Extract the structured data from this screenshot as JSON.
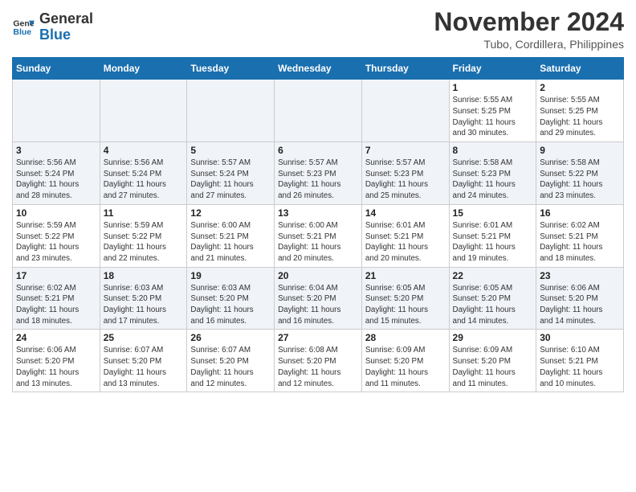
{
  "logo": {
    "line1": "General",
    "line2": "Blue"
  },
  "title": "November 2024",
  "subtitle": "Tubo, Cordillera, Philippines",
  "days_of_week": [
    "Sunday",
    "Monday",
    "Tuesday",
    "Wednesday",
    "Thursday",
    "Friday",
    "Saturday"
  ],
  "weeks": [
    [
      {
        "day": "",
        "info": ""
      },
      {
        "day": "",
        "info": ""
      },
      {
        "day": "",
        "info": ""
      },
      {
        "day": "",
        "info": ""
      },
      {
        "day": "",
        "info": ""
      },
      {
        "day": "1",
        "info": "Sunrise: 5:55 AM\nSunset: 5:25 PM\nDaylight: 11 hours\nand 30 minutes."
      },
      {
        "day": "2",
        "info": "Sunrise: 5:55 AM\nSunset: 5:25 PM\nDaylight: 11 hours\nand 29 minutes."
      }
    ],
    [
      {
        "day": "3",
        "info": "Sunrise: 5:56 AM\nSunset: 5:24 PM\nDaylight: 11 hours\nand 28 minutes."
      },
      {
        "day": "4",
        "info": "Sunrise: 5:56 AM\nSunset: 5:24 PM\nDaylight: 11 hours\nand 27 minutes."
      },
      {
        "day": "5",
        "info": "Sunrise: 5:57 AM\nSunset: 5:24 PM\nDaylight: 11 hours\nand 27 minutes."
      },
      {
        "day": "6",
        "info": "Sunrise: 5:57 AM\nSunset: 5:23 PM\nDaylight: 11 hours\nand 26 minutes."
      },
      {
        "day": "7",
        "info": "Sunrise: 5:57 AM\nSunset: 5:23 PM\nDaylight: 11 hours\nand 25 minutes."
      },
      {
        "day": "8",
        "info": "Sunrise: 5:58 AM\nSunset: 5:23 PM\nDaylight: 11 hours\nand 24 minutes."
      },
      {
        "day": "9",
        "info": "Sunrise: 5:58 AM\nSunset: 5:22 PM\nDaylight: 11 hours\nand 23 minutes."
      }
    ],
    [
      {
        "day": "10",
        "info": "Sunrise: 5:59 AM\nSunset: 5:22 PM\nDaylight: 11 hours\nand 23 minutes."
      },
      {
        "day": "11",
        "info": "Sunrise: 5:59 AM\nSunset: 5:22 PM\nDaylight: 11 hours\nand 22 minutes."
      },
      {
        "day": "12",
        "info": "Sunrise: 6:00 AM\nSunset: 5:21 PM\nDaylight: 11 hours\nand 21 minutes."
      },
      {
        "day": "13",
        "info": "Sunrise: 6:00 AM\nSunset: 5:21 PM\nDaylight: 11 hours\nand 20 minutes."
      },
      {
        "day": "14",
        "info": "Sunrise: 6:01 AM\nSunset: 5:21 PM\nDaylight: 11 hours\nand 20 minutes."
      },
      {
        "day": "15",
        "info": "Sunrise: 6:01 AM\nSunset: 5:21 PM\nDaylight: 11 hours\nand 19 minutes."
      },
      {
        "day": "16",
        "info": "Sunrise: 6:02 AM\nSunset: 5:21 PM\nDaylight: 11 hours\nand 18 minutes."
      }
    ],
    [
      {
        "day": "17",
        "info": "Sunrise: 6:02 AM\nSunset: 5:21 PM\nDaylight: 11 hours\nand 18 minutes."
      },
      {
        "day": "18",
        "info": "Sunrise: 6:03 AM\nSunset: 5:20 PM\nDaylight: 11 hours\nand 17 minutes."
      },
      {
        "day": "19",
        "info": "Sunrise: 6:03 AM\nSunset: 5:20 PM\nDaylight: 11 hours\nand 16 minutes."
      },
      {
        "day": "20",
        "info": "Sunrise: 6:04 AM\nSunset: 5:20 PM\nDaylight: 11 hours\nand 16 minutes."
      },
      {
        "day": "21",
        "info": "Sunrise: 6:05 AM\nSunset: 5:20 PM\nDaylight: 11 hours\nand 15 minutes."
      },
      {
        "day": "22",
        "info": "Sunrise: 6:05 AM\nSunset: 5:20 PM\nDaylight: 11 hours\nand 14 minutes."
      },
      {
        "day": "23",
        "info": "Sunrise: 6:06 AM\nSunset: 5:20 PM\nDaylight: 11 hours\nand 14 minutes."
      }
    ],
    [
      {
        "day": "24",
        "info": "Sunrise: 6:06 AM\nSunset: 5:20 PM\nDaylight: 11 hours\nand 13 minutes."
      },
      {
        "day": "25",
        "info": "Sunrise: 6:07 AM\nSunset: 5:20 PM\nDaylight: 11 hours\nand 13 minutes."
      },
      {
        "day": "26",
        "info": "Sunrise: 6:07 AM\nSunset: 5:20 PM\nDaylight: 11 hours\nand 12 minutes."
      },
      {
        "day": "27",
        "info": "Sunrise: 6:08 AM\nSunset: 5:20 PM\nDaylight: 11 hours\nand 12 minutes."
      },
      {
        "day": "28",
        "info": "Sunrise: 6:09 AM\nSunset: 5:20 PM\nDaylight: 11 hours\nand 11 minutes."
      },
      {
        "day": "29",
        "info": "Sunrise: 6:09 AM\nSunset: 5:20 PM\nDaylight: 11 hours\nand 11 minutes."
      },
      {
        "day": "30",
        "info": "Sunrise: 6:10 AM\nSunset: 5:21 PM\nDaylight: 11 hours\nand 10 minutes."
      }
    ]
  ]
}
